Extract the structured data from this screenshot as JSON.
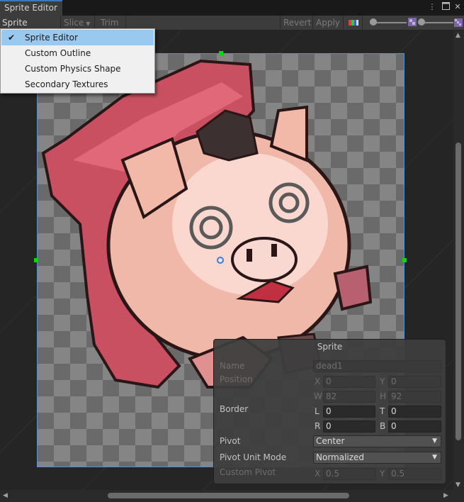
{
  "window": {
    "tab_title": "Sprite Editor",
    "menu_icon": "vertical-dots-icon",
    "maximize_icon": "maximize-icon",
    "close_icon": "close-icon"
  },
  "toolbar": {
    "mode_label": "Sprite Editor",
    "slice_label": "Slice",
    "trim_label": "Trim",
    "revert_label": "Revert",
    "apply_label": "Apply",
    "color_channel_icon": "color-channel-icon",
    "zoom_level": 0.5,
    "mip_level": 0.5,
    "mip_icon": "mip-level-icon"
  },
  "mode_menu": {
    "items": [
      {
        "label": "Sprite Editor",
        "checked": true
      },
      {
        "label": "Custom Outline",
        "checked": false
      },
      {
        "label": "Custom Physics Shape",
        "checked": false
      },
      {
        "label": "Secondary Textures",
        "checked": false
      }
    ],
    "check_icon": "checkmark-icon"
  },
  "sprite_panel": {
    "title": "Sprite",
    "name_label": "Name",
    "name_value": "dead1",
    "position_label": "Position",
    "position": {
      "x_label": "X",
      "x": "0",
      "y_label": "Y",
      "y": "0",
      "w_label": "W",
      "w": "82",
      "h_label": "H",
      "h": "92"
    },
    "border_label": "Border",
    "border": {
      "l_label": "L",
      "l": "0",
      "t_label": "T",
      "t": "0",
      "r_label": "R",
      "r": "0",
      "b_label": "B",
      "b": "0"
    },
    "pivot_label": "Pivot",
    "pivot_value": "Center",
    "pivot_unit_label": "Pivot Unit Mode",
    "pivot_unit_value": "Normalized",
    "custom_pivot_label": "Custom Pivot",
    "custom_pivot": {
      "x_label": "X",
      "x": "0.5",
      "y_label": "Y",
      "y": "0.5"
    }
  },
  "colors": {
    "selection_border": "#5f8fc8",
    "handle": "#00dd00",
    "pivot": "#3b7de0",
    "menu_highlight": "#99c9ef",
    "active_tab_accent": "#3a79bb"
  }
}
